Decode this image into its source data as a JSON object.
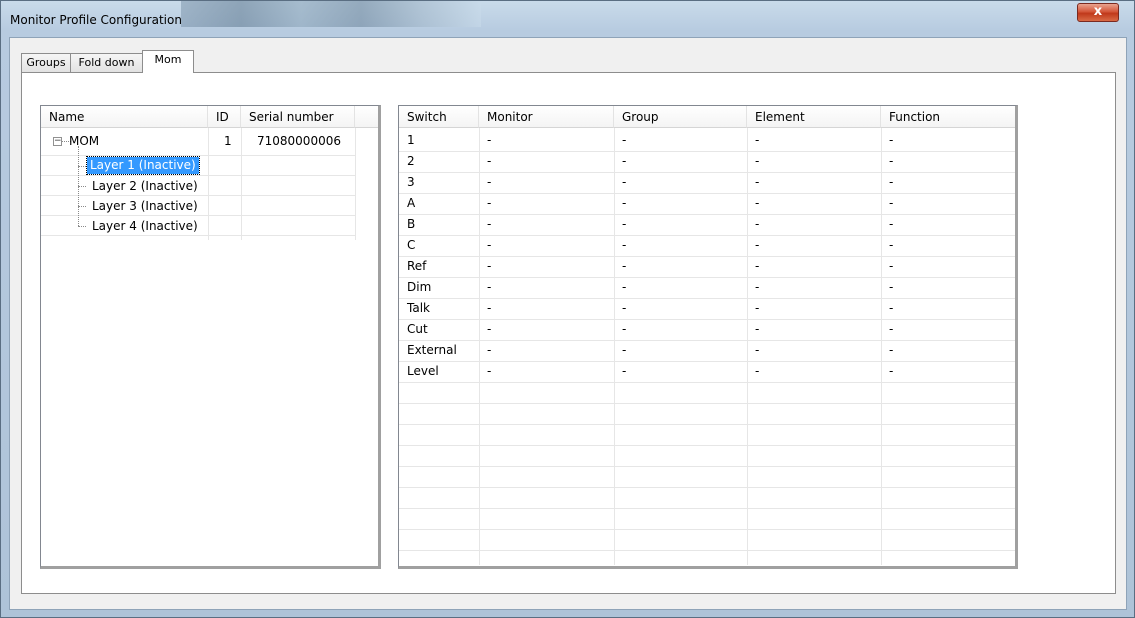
{
  "window": {
    "title": "Monitor Profile Configuration",
    "close_label": "x"
  },
  "tabs": [
    {
      "label": "Groups"
    },
    {
      "label": "Fold down"
    },
    {
      "label": "Mom",
      "active": true
    }
  ],
  "devices": {
    "columns": [
      "Name",
      "ID",
      "Serial number"
    ],
    "root": {
      "toggle": "−",
      "name": "MOM",
      "id": "1",
      "serial": "71080000006"
    },
    "layers": [
      {
        "name": "Layer 1 (Inactive)",
        "selected": true
      },
      {
        "name": "Layer 2 (Inactive)"
      },
      {
        "name": "Layer 3 (Inactive)"
      },
      {
        "name": "Layer 4 (Inactive)"
      }
    ]
  },
  "switches": {
    "columns": [
      "Switch",
      "Monitor",
      "Group",
      "Element",
      "Function"
    ],
    "rows": [
      {
        "switch": "1",
        "monitor": "-",
        "group": "-",
        "element": "-",
        "function": "-"
      },
      {
        "switch": "2",
        "monitor": "-",
        "group": "-",
        "element": "-",
        "function": "-"
      },
      {
        "switch": "3",
        "monitor": "-",
        "group": "-",
        "element": "-",
        "function": "-"
      },
      {
        "switch": "A",
        "monitor": "-",
        "group": "-",
        "element": "-",
        "function": "-"
      },
      {
        "switch": "B",
        "monitor": "-",
        "group": "-",
        "element": "-",
        "function": "-"
      },
      {
        "switch": "C",
        "monitor": "-",
        "group": "-",
        "element": "-",
        "function": "-"
      },
      {
        "switch": "Ref",
        "monitor": "-",
        "group": "-",
        "element": "-",
        "function": "-"
      },
      {
        "switch": "Dim",
        "monitor": "-",
        "group": "-",
        "element": "-",
        "function": "-"
      },
      {
        "switch": "Talk",
        "monitor": "-",
        "group": "-",
        "element": "-",
        "function": "-"
      },
      {
        "switch": "Cut",
        "monitor": "-",
        "group": "-",
        "element": "-",
        "function": "-"
      },
      {
        "switch": "External",
        "monitor": "-",
        "group": "-",
        "element": "-",
        "function": "-"
      },
      {
        "switch": "Level",
        "monitor": "-",
        "group": "-",
        "element": "-",
        "function": "-"
      }
    ]
  }
}
